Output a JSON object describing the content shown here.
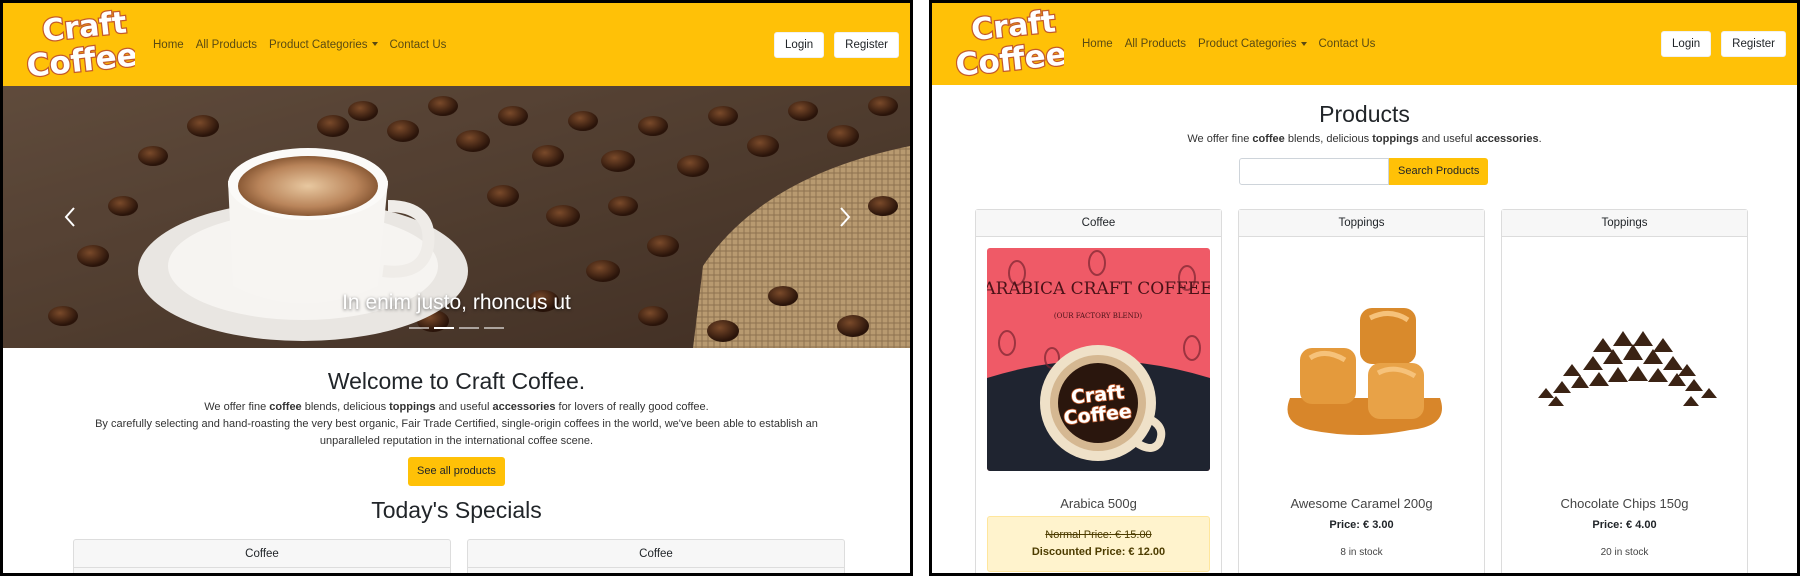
{
  "brand": {
    "logo_text": "Craft Coffee"
  },
  "nav": {
    "home": "Home",
    "all_products": "All Products",
    "categories": "Product Categories",
    "contact": "Contact Us",
    "login": "Login",
    "register": "Register"
  },
  "home": {
    "carousel_caption": "In enim justo, rhoncus ut",
    "carousel_slides": 4,
    "carousel_active_index": 1,
    "welcome_title": "Welcome to Craft Coffee.",
    "intro_line1_pre": "We offer fine ",
    "intro_coffee": "coffee",
    "intro_line1_mid": " blends, delicious ",
    "intro_toppings": "toppings",
    "intro_line1_mid2": " and useful ",
    "intro_accessories": "accessories",
    "intro_line1_post": " for lovers of really good coffee.",
    "intro_line2": "By carefully selecting and hand-roasting the very best organic, Fair Trade Certified, single-origin coffees in the world, we've been able to establish an",
    "intro_line3": "unparalleled reputation in the international coffee scene.",
    "see_all_button": "See all products",
    "specials_title": "Today's Specials",
    "special_cards": [
      "Coffee",
      "Coffee"
    ]
  },
  "products_page": {
    "title": "Products",
    "sub_pre": "We offer fine ",
    "sub_coffee": "coffee",
    "sub_mid": " blends, delicious ",
    "sub_toppings": "toppings",
    "sub_mid2": " and useful ",
    "sub_accessories": "accessories",
    "sub_post": ".",
    "search_value": "",
    "search_button": "Search Products",
    "cards": [
      {
        "category": "Coffee",
        "name": "Arabica 500g",
        "normal_price": "Normal Price: € 15.00",
        "discounted_price": "Discounted Price: € 12.00",
        "package_title": "ARABICA CRAFT COFFEE",
        "package_sub": "(OUR FACTORY BLEND)"
      },
      {
        "category": "Toppings",
        "name": "Awesome Caramel 200g",
        "price": "Price: € 3.00",
        "stock": "8 in stock"
      },
      {
        "category": "Toppings",
        "name": "Chocolate Chips 150g",
        "price": "Price: € 4.00",
        "stock": "20 in stock"
      }
    ]
  },
  "colors": {
    "accent": "#ffc107",
    "discount_bg": "#fff3cd"
  }
}
